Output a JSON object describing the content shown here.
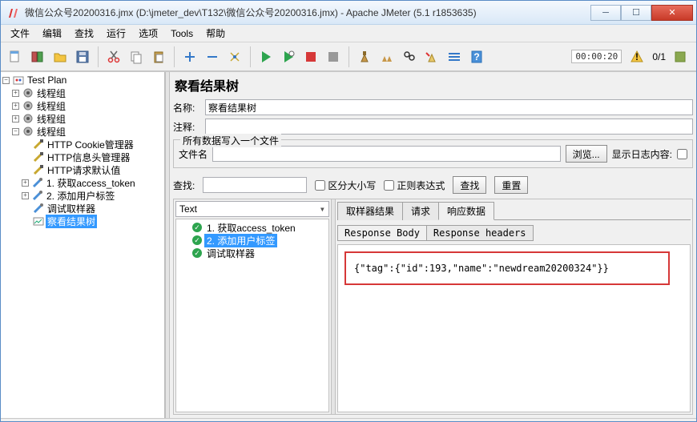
{
  "window": {
    "title": "微信公众号20200316.jmx (D:\\jmeter_dev\\T132\\微信公众号20200316.jmx) - Apache JMeter (5.1 r1853635)"
  },
  "menu": {
    "file": "文件",
    "edit": "编辑",
    "find": "查找",
    "run": "运行",
    "options": "选项",
    "tools": "Tools",
    "help": "帮助"
  },
  "toolbar": {
    "elapsed_time": "00:00:20",
    "thread_count": "0/1"
  },
  "tree": {
    "root": "Test Plan",
    "tg1": "线程组",
    "tg2": "线程组",
    "tg3": "线程组",
    "tg4": "线程组",
    "cookie": "HTTP Cookie管理器",
    "header": "HTTP信息头管理器",
    "defaults": "HTTP请求默认值",
    "step1": "1. 获取access_token",
    "step2": "2. 添加用户标签",
    "debug": "调试取样器",
    "results": "察看结果树"
  },
  "panel": {
    "title": "察看结果树",
    "name_label": "名称:",
    "name_value": "察看结果树",
    "comment_label": "注释:",
    "comment_value": "",
    "file_group_legend": "所有数据写入一个文件",
    "filename_label": "文件名",
    "filename_value": "",
    "browse_btn": "浏览...",
    "logshow_label": "显示日志内容:",
    "search_label": "查找:",
    "search_value": "",
    "case_label": "区分大小写",
    "regex_label": "正则表达式",
    "search_btn": "查找",
    "reset_btn": "重置",
    "renderer": "Text"
  },
  "results": {
    "r1": "1. 获取access_token",
    "r2": "2. 添加用户标签",
    "r3": "调试取样器"
  },
  "tabs": {
    "sampler": "取样器结果",
    "request": "请求",
    "response": "响应数据"
  },
  "subtabs": {
    "body": "Response Body",
    "headers": "Response headers"
  },
  "response": {
    "body": "{\"tag\":{\"id\":193,\"name\":\"newdream20200324\"}}"
  }
}
